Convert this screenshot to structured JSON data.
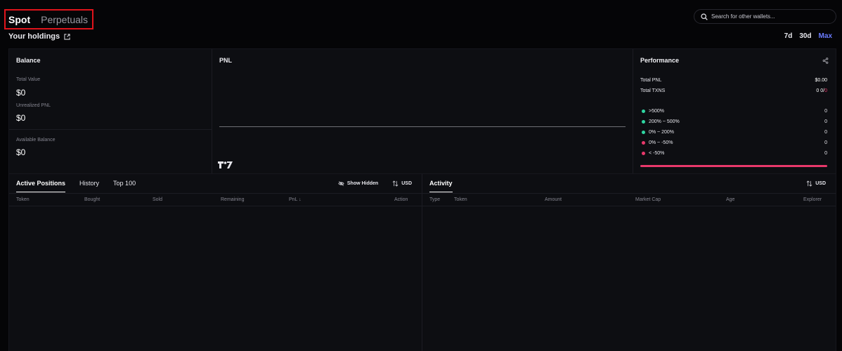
{
  "top_tabs": {
    "spot": "Spot",
    "perpetuals": "Perpetuals"
  },
  "holdings_label": "Your holdings",
  "search": {
    "placeholder": "Search for other wallets..."
  },
  "timeframes": [
    "7d",
    "30d",
    "Max"
  ],
  "timeframe_selected": "Max",
  "balance": {
    "title": "Balance",
    "total_value_label": "Total Value",
    "total_value": "$0",
    "unrealized_pnl_label": "Unrealized PNL",
    "unrealized_pnl": "$0",
    "available_balance_label": "Available Balance",
    "available_balance": "$0"
  },
  "pnl": {
    "title": "PNL"
  },
  "performance": {
    "title": "Performance",
    "total_pnl_label": "Total PNL",
    "total_pnl": "$0.00",
    "total_txns_label": "Total TXNS",
    "total_txns_buys": "0",
    "total_txns_sells": "0",
    "total_txns_sep": "/",
    "buckets": [
      {
        "label": ">500%",
        "value": "0",
        "color": "#2fd6a2"
      },
      {
        "label": "200% ~ 500%",
        "value": "0",
        "color": "#2fd6a2"
      },
      {
        "label": "0% ~ 200%",
        "value": "0",
        "color": "#2fd6a2"
      },
      {
        "label": "0% ~ -50%",
        "value": "0",
        "color": "#e8386b"
      },
      {
        "label": "< -50%",
        "value": "0",
        "color": "#e8386b"
      }
    ],
    "bar_color": "#e8386b"
  },
  "positions": {
    "tabs": [
      "Active Positions",
      "History",
      "Top 100"
    ],
    "active_tab": "Active Positions",
    "show_hidden": "Show Hidden",
    "currency": "USD",
    "columns": [
      "Token",
      "Bought",
      "Sold",
      "Remaining",
      "PnL ↓",
      "Action"
    ]
  },
  "activity": {
    "tab": "Activity",
    "currency": "USD",
    "columns": [
      "Type",
      "Token",
      "Amount",
      "Market Cap",
      "Age",
      "Explorer"
    ]
  },
  "colors": {
    "accent": "#6b7cff",
    "highlight_box": "#e0141b",
    "positive": "#2fd6a2",
    "negative": "#e8386b"
  }
}
